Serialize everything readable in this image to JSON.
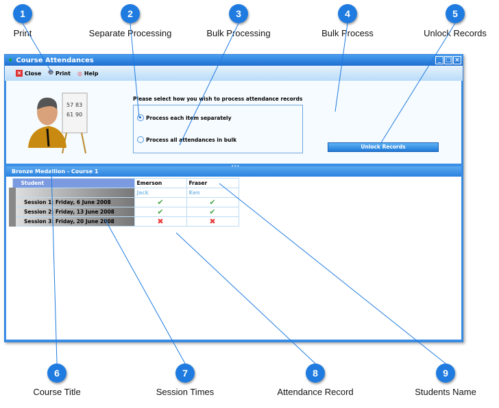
{
  "callouts_top": [
    {
      "n": "1",
      "label": "Print"
    },
    {
      "n": "2",
      "label": "Separate Processing"
    },
    {
      "n": "3",
      "label": "Bulk Processing"
    },
    {
      "n": "4",
      "label": "Bulk Process"
    },
    {
      "n": "5",
      "label": "Unlock Records"
    }
  ],
  "callouts_bottom": [
    {
      "n": "6",
      "label": "Course Title"
    },
    {
      "n": "7",
      "label": "Session Times"
    },
    {
      "n": "8",
      "label": "Attendance Record"
    },
    {
      "n": "9",
      "label": "Students Name"
    }
  ],
  "window": {
    "title": "Course Attendances"
  },
  "toolbar": {
    "close": "Close",
    "print": "Print",
    "help": "Help"
  },
  "process": {
    "prompt": "Please select how you wish to process attendance records",
    "option_separate": "Process each item separately",
    "option_bulk": "Process all attendances in bulk",
    "selected": "separate",
    "unlock": "Unlock Records"
  },
  "chart_card": {
    "a": "57",
    "b": "83",
    "c": "61",
    "d": "90"
  },
  "course": {
    "title": "Bronze Medallion - Course 1"
  },
  "grid": {
    "student_header": "Student",
    "students": [
      {
        "last": "Emerson",
        "first": "Jack"
      },
      {
        "last": "Fraser",
        "first": "Ken"
      }
    ],
    "sessions": [
      {
        "label": "Session 1: Friday, 6 June 2008",
        "attended": [
          true,
          true
        ]
      },
      {
        "label": "Session 2: Friday, 13 June 2008",
        "attended": [
          true,
          true
        ]
      },
      {
        "label": "Session 3: Friday, 20 June 2008",
        "attended": [
          false,
          false
        ]
      }
    ]
  },
  "colors": {
    "callout": "#1f7be0",
    "title_bar": "#2a82de"
  }
}
